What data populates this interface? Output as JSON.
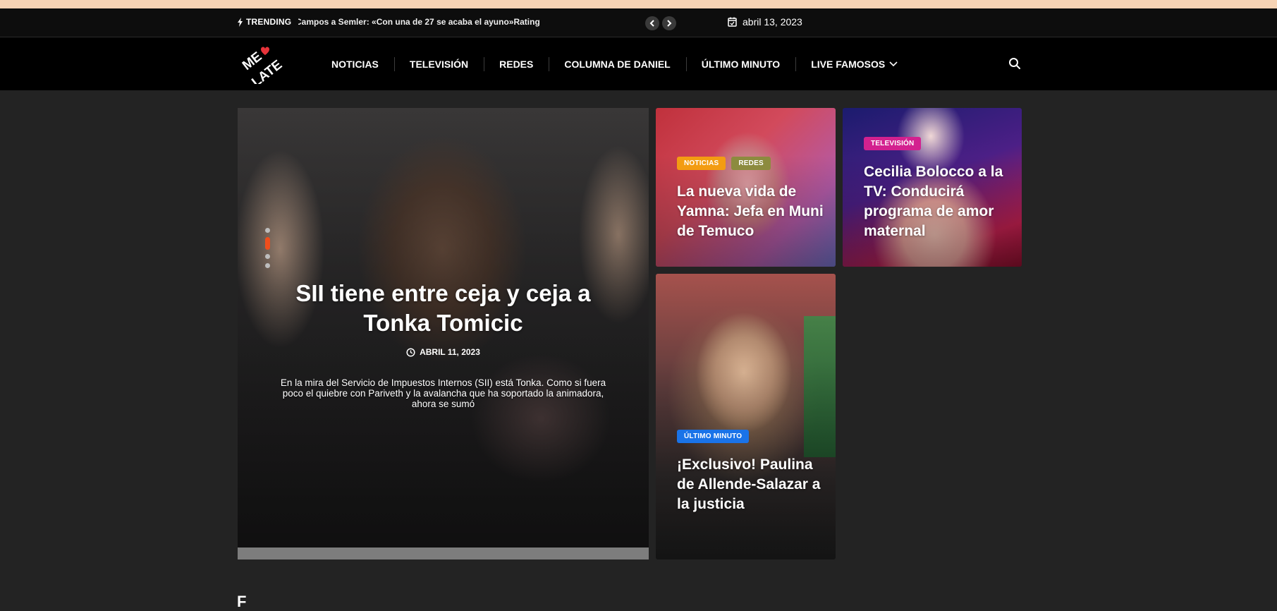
{
  "trending": {
    "label": "TRENDING",
    "headline": "Campos a Semler: «Con una de 27 se acaba el ayuno»Rating"
  },
  "date": "abril 13, 2023",
  "nav": {
    "logo_text": "MELATE",
    "items": [
      {
        "label": "NOTICIAS"
      },
      {
        "label": "TELEVISIÓN"
      },
      {
        "label": "REDES"
      },
      {
        "label": "COLUMNA DE DANIEL"
      },
      {
        "label": "ÚLTIMO MINUTO"
      },
      {
        "label": "LIVE FAMOSOS"
      }
    ]
  },
  "hero": {
    "title": "SII tiene entre ceja y ceja a Tonka Tomicic",
    "date": "ABRIL 11, 2023",
    "excerpt": "En la mira del Servicio de Impuestos Internos (SII) está Tonka. Como si fuera poco el quiebre con Pariveth y la avalancha que ha soportado la animadora, ahora se sumó",
    "slides_total": 4,
    "slide_active": 2
  },
  "cards": [
    {
      "badges": [
        {
          "label": "NOTICIAS",
          "color": "#f39c12"
        },
        {
          "label": "REDES",
          "color": "#8c8b3e"
        }
      ],
      "title": "La nueva vida de Yamna: Jefa en Muni de Temuco"
    },
    {
      "badges": [
        {
          "label": "TELEVISIÓN",
          "color": "#d3218f"
        }
      ],
      "title": "Cecilia Bolocco a la TV: Conducirá programa de amor maternal"
    },
    {
      "badges": [
        {
          "label": "ÚLTIMO MINUTO",
          "color": "#1a73e8"
        }
      ],
      "title": "¡Exclusivo! Paulina de Allende-Salazar a la justicia"
    }
  ],
  "section_peek": "F",
  "colors": {
    "accent": "#f04e1c",
    "background": "#232323",
    "nav_background": "#000000"
  }
}
